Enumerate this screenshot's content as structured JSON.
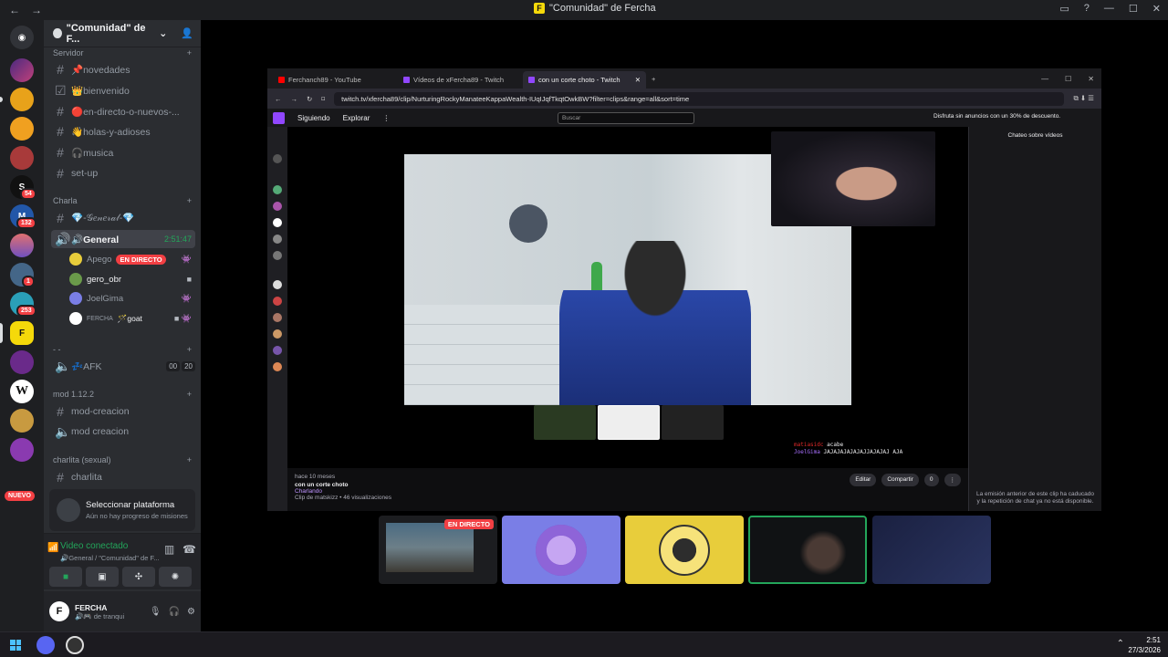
{
  "window": {
    "title": "\"Comunidad\" de Fercha",
    "title_icon": "F"
  },
  "server": {
    "name": "\"Comunidad\" de F..."
  },
  "categories": {
    "servidor": "Servidor",
    "charla": "Charla",
    "dash": "- -",
    "mod": "mod 1.12.2",
    "charlita": "charlita (sexual)"
  },
  "channels": {
    "novedades": "📌novedades",
    "bienvenido": "👑bienvenido",
    "en_directo": "🔴en-directo-o-nuevos-...",
    "holas": "👋holas-y-adioses",
    "musica": "🎧musica",
    "setup": "set-up",
    "general_fancy": "💎-𝒢𝑒𝓃𝑒𝓇𝒶𝓁-💎",
    "general_voice": "🔊General",
    "general_time": "2:51:47",
    "afk": "💤AFK",
    "afk_count_a": "00",
    "afk_count_b": "20",
    "mod_creacion_1": "mod-creacion",
    "mod_creacion_2": "mod creacion",
    "charlita": "charlita"
  },
  "voice_users": [
    {
      "name": "Apego",
      "live": "EN DIRECTO"
    },
    {
      "name": "gero_obr"
    },
    {
      "name": "JoelGima"
    },
    {
      "name": "FERCHA",
      "tag": "🪄goat"
    }
  ],
  "rail": {
    "badges": [
      "54",
      "132",
      "1",
      "253"
    ],
    "new_label": "NUEVO"
  },
  "quest": {
    "title": "Seleccionar plataforma",
    "subtitle": "Aún no hay progreso de misiones"
  },
  "voice_panel": {
    "status": "Video conectado",
    "location": "🔊General / \"Comunidad\" de F..."
  },
  "user_panel": {
    "name": "FERCHA",
    "status": "🔊🎮 de tranqui"
  },
  "browser": {
    "tabs": [
      "Ferchanch89 - YouTube",
      "Vídeos de xFercha89 - Twitch",
      "con un corte choto - Twitch"
    ],
    "url": "twitch.tv/xfercha89/clip/NurturingRockyManateeKappaWealth-IUqIJqfTkqtOwkBW?filter=clips&range=all&sort=time",
    "nav": {
      "following": "Siguiendo",
      "explore": "Explorar",
      "search_placeholder": "Buscar",
      "promo": "Disfruta sin anuncios con un 30% de descuento."
    },
    "chat_header": "Chateo sobre vídeos",
    "chat_message": "La emisión anterior de este clip ha caducado y la repetición de chat ya no está disponible.",
    "clip_chat": [
      {
        "user": "matiasidc",
        "text": "acabe"
      },
      {
        "user": "JoelGima",
        "text": "JAJAJAJAJAJAJJAJAJAJ AJA"
      }
    ],
    "clip": {
      "ago": "hace 10 meses",
      "title": "con un corte choto",
      "category": "Charlando",
      "meta": "Clip de matskizz • 46 visualizaciones",
      "edit": "Editar",
      "share": "Compartir",
      "likes": "0"
    }
  },
  "tiles": {
    "live": "EN DIRECTO"
  },
  "taskbar": {
    "time": "2:51",
    "date": "27/3/2026"
  },
  "colors": {
    "discord_bg": "#2b2d31",
    "rail_bg": "#1e1f22",
    "accent_green": "#23a55a",
    "live_red": "#f23f43",
    "twitch_purple": "#9147ff"
  }
}
